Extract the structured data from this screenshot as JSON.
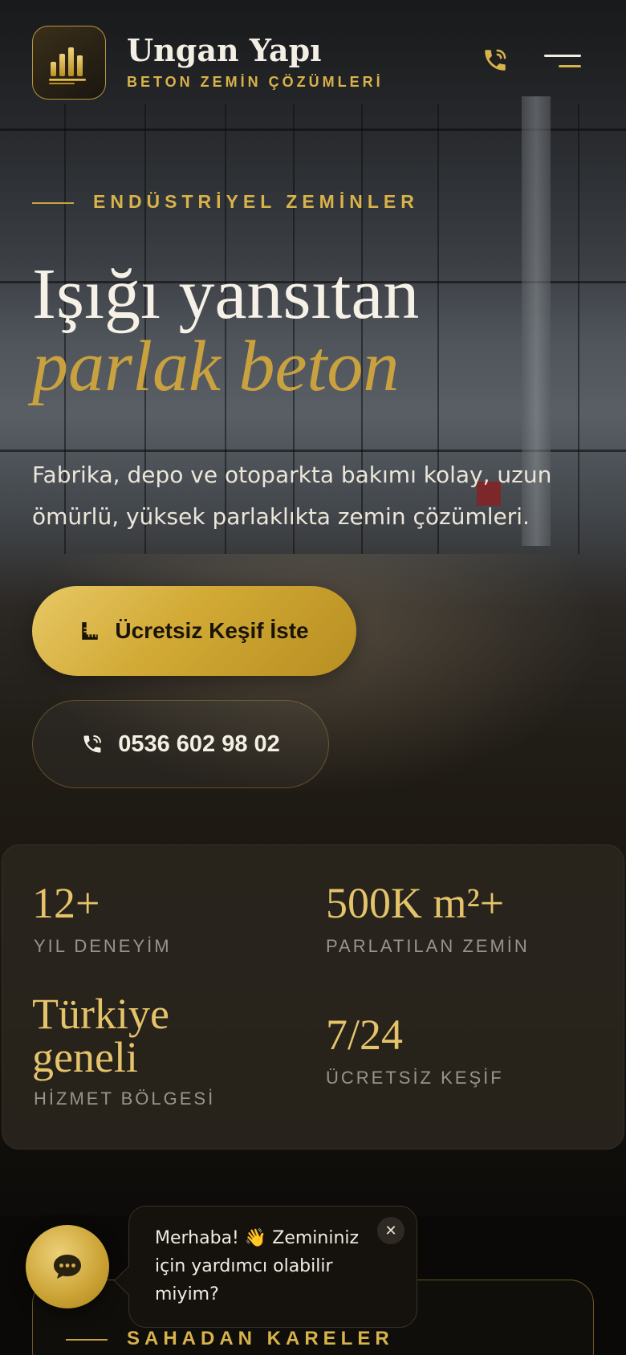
{
  "header": {
    "brand_name": "Ungan Yapı",
    "brand_tagline": "BETON ZEMİN ÇÖZÜMLERİ"
  },
  "hero": {
    "eyebrow": "ENDÜSTRİYEL ZEMİNLER",
    "headline_line1": "Işığı yansıtan",
    "headline_line2": "parlak beton",
    "lead": "Fabrika, depo ve otoparkta bakımı kolay, uzun ömürlü, yüksek parlaklıkta zemin çözümleri.",
    "cta_primary": "Ücretsiz Keşif İste",
    "cta_phone": "0536 602 98 02"
  },
  "stats": [
    {
      "value": "12+",
      "label": "YIL DENEYİM"
    },
    {
      "value": "500K m²+",
      "label": "PARLATILAN ZEMİN"
    },
    {
      "value_line1": "Türkiye",
      "value_line2": "geneli",
      "label": "HİZMET BÖLGESİ"
    },
    {
      "value": "7/24",
      "label": "ÜCRETSİZ KEŞİF"
    }
  ],
  "gallery": {
    "title": "SAHADAN KARELER"
  },
  "chat": {
    "message": "Merhaba! 👋 Zemininiz için yardımcı olabilir miyim?",
    "close_glyph": "✕"
  },
  "colors": {
    "gold": "#d8b24a",
    "gold_light": "#e4c36a",
    "background": "#0b0a08"
  }
}
